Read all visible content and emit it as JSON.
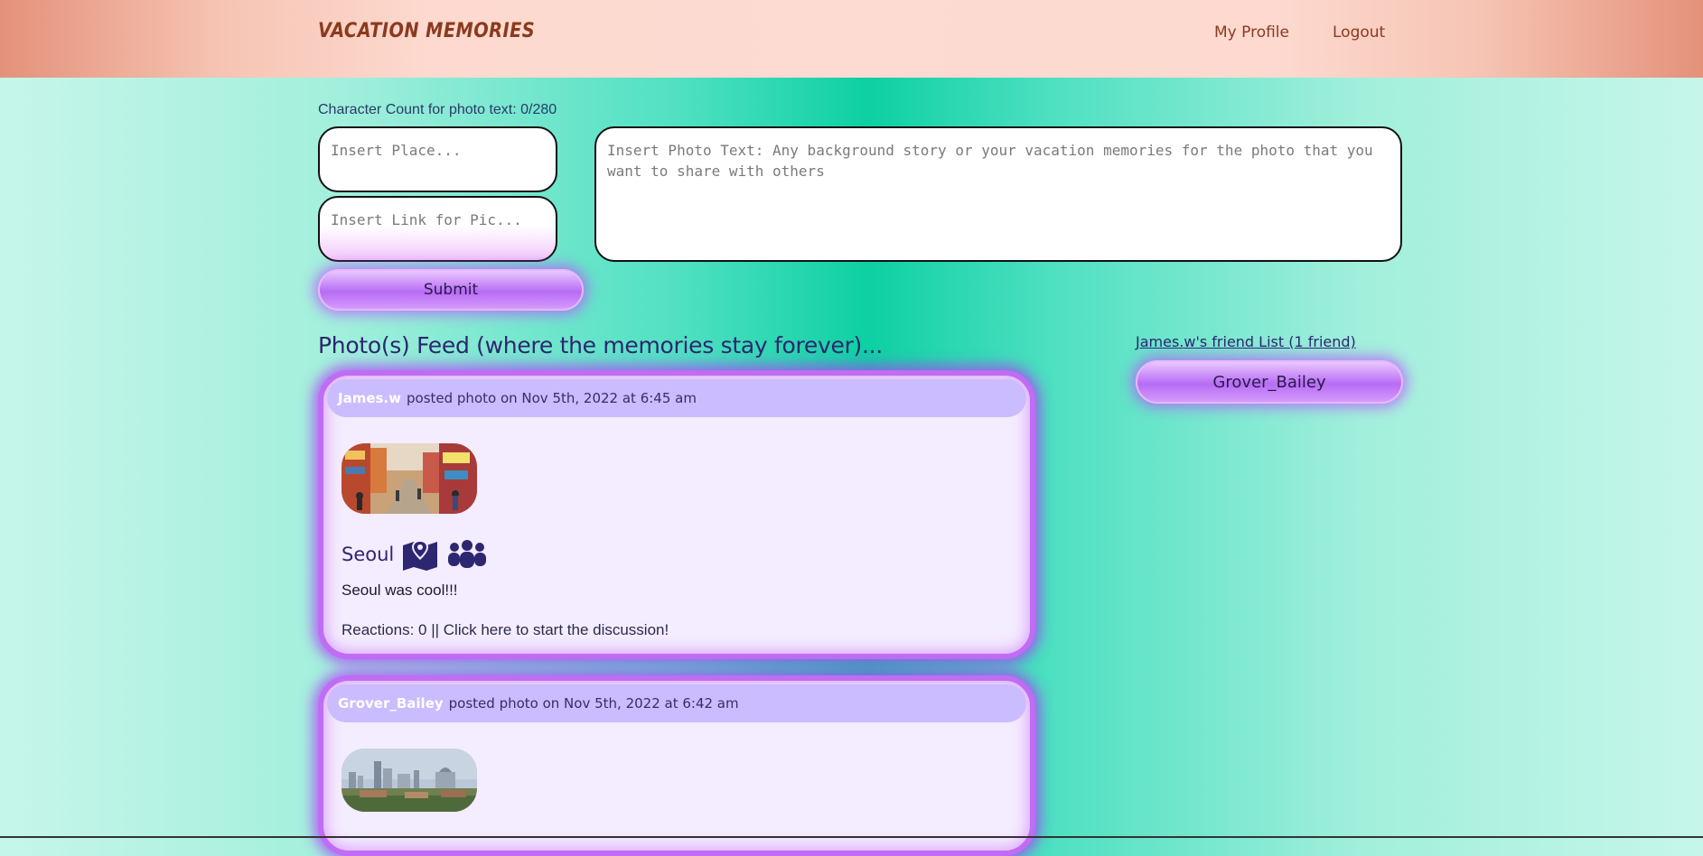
{
  "header": {
    "brand": "VACATION MEMORIES",
    "nav": {
      "profile": "My Profile",
      "logout": "Logout"
    }
  },
  "form": {
    "char_count": "Character Count for photo text: 0/280",
    "place_placeholder": "Insert Place...",
    "link_placeholder": "Insert Link for Pic...",
    "photo_text_placeholder": "Insert Photo Text: Any background story or your vacation memories for the photo that you want to share with others",
    "submit_label": "Submit"
  },
  "feed": {
    "title": "Photo(s) Feed (where the memories stay forever)...",
    "posts": [
      {
        "user": "James.w",
        "meta": "posted photo on Nov 5th, 2022 at 6:45 am",
        "place": "Seoul",
        "caption": "Seoul was cool!!!",
        "reactions": "Reactions: 0 || Click here to start the discussion!"
      },
      {
        "user": "Grover_Bailey",
        "meta": "posted photo on Nov 5th, 2022 at 6:42 am"
      }
    ]
  },
  "friends": {
    "title": "James.w's friend List (1 friend)",
    "items": [
      "Grover_Bailey"
    ]
  },
  "icons": [
    "map-marked-icon",
    "group-people-icon"
  ],
  "colors": {
    "accent": "#c06cf4",
    "header_bg": "#cbbcff",
    "text_dark": "#2d2670",
    "brand": "#8b3a1e"
  }
}
